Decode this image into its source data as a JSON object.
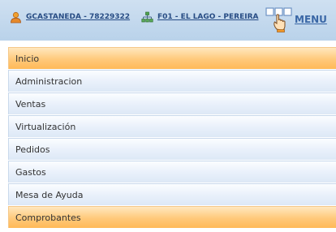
{
  "header": {
    "user_label": "GCASTANEDA - 78229322",
    "branch_label": "F01 - EL LAGO - PEREIRA",
    "menu_label": "MENU"
  },
  "nav": {
    "items": [
      {
        "label": "Inicio",
        "active": true
      },
      {
        "label": "Administracion",
        "active": false
      },
      {
        "label": "Ventas",
        "active": false
      },
      {
        "label": "Virtualización",
        "active": false
      },
      {
        "label": "Pedidos",
        "active": false
      },
      {
        "label": "Gastos",
        "active": false
      },
      {
        "label": "Mesa de Ayuda",
        "active": false
      },
      {
        "label": "Comprobantes",
        "active": true
      }
    ]
  },
  "colors": {
    "header_bg": "#c3d9ee",
    "link": "#274c84",
    "active_item": "#ffc97a",
    "item_bg": "#eaf1fb"
  }
}
